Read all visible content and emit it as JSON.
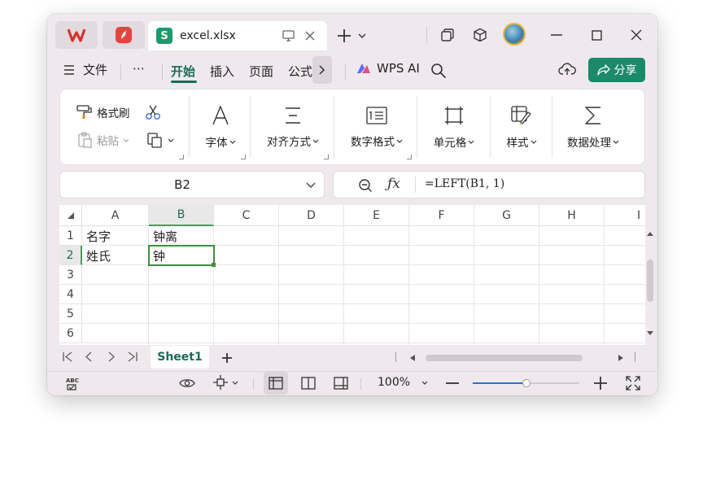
{
  "titlebar": {
    "tab_title": "excel.xlsx",
    "tab_icon_letter": "S",
    "colors": {
      "sheet_icon": "#1d9a6c",
      "wps_logo": "#d6332d"
    }
  },
  "menu": {
    "file_label": "文件",
    "more_label": "⋯",
    "tabs": [
      "开始",
      "插入",
      "页面",
      "公式"
    ],
    "active_tab": "开始",
    "wps_ai_label": "WPS AI",
    "share_label": "分享"
  },
  "ribbon": {
    "format_painter": "格式刷",
    "paste": "粘贴",
    "groups": [
      "字体",
      "对齐方式",
      "数字格式",
      "单元格",
      "样式",
      "数据处理"
    ]
  },
  "formula_bar": {
    "name_box": "B2",
    "formula": "=LEFT(B1, 1)"
  },
  "grid": {
    "columns": [
      "A",
      "B",
      "C",
      "D",
      "E",
      "F",
      "G",
      "H",
      "I"
    ],
    "rows": [
      "1",
      "2",
      "3",
      "4",
      "5",
      "6"
    ],
    "selected_column": "B",
    "selected_row": "2",
    "cells": {
      "A1": "名字",
      "B1": "钟离",
      "A2": "姓氏",
      "B2": "钟"
    }
  },
  "sheets": {
    "tabs": [
      "Sheet1"
    ],
    "active": "Sheet1"
  },
  "status": {
    "zoom": "100%",
    "zoom_fraction": 0.5
  },
  "accent_color": "#1a6c54"
}
